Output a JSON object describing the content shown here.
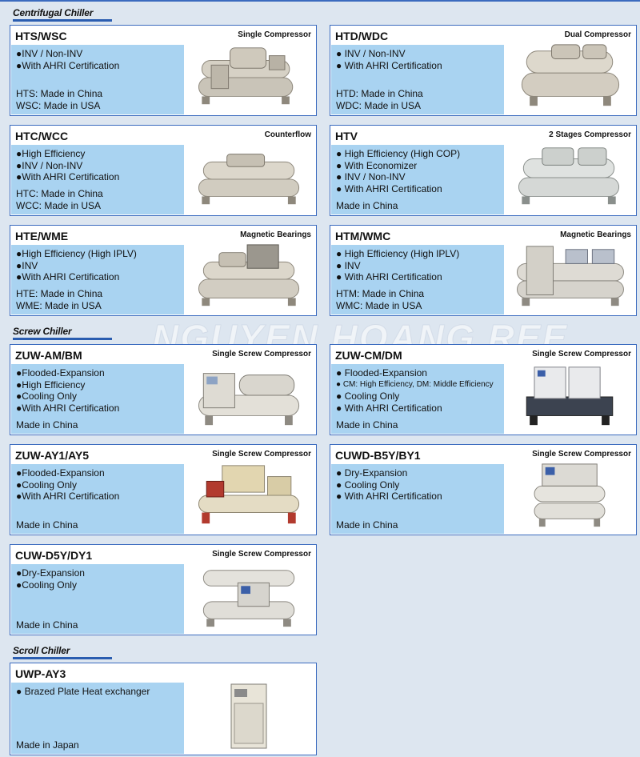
{
  "sections": {
    "centrifugal": "Centrifugal Chiller",
    "screw": "Screw Chiller",
    "scroll": "Scroll Chiller"
  },
  "watermark": "NGUYEN HOANG REE",
  "cards": {
    "hts": {
      "name": "HTS/WSC",
      "tag": "Single Compressor",
      "bullets": [
        "●INV / Non-INV",
        "●With AHRI Certification"
      ],
      "origin": [
        "HTS: Made in China",
        "WSC: Made in USA"
      ]
    },
    "htd": {
      "name": "HTD/WDC",
      "tag": "Dual Compressor",
      "bullets": [
        "● INV / Non-INV",
        "● With AHRI Certification"
      ],
      "origin": [
        "HTD: Made in China",
        "WDC: Made in USA"
      ]
    },
    "htc": {
      "name": "HTC/WCC",
      "tag": "Counterflow",
      "bullets": [
        "●High Efficiency",
        "●INV / Non-INV",
        "●With AHRI Certification"
      ],
      "origin": [
        "HTC: Made in China",
        "WCC: Made in USA"
      ]
    },
    "htv": {
      "name": "HTV",
      "tag": "2 Stages Compressor",
      "bullets": [
        "● High Efficiency (High COP)",
        "● With Economizer",
        "● INV / Non-INV",
        "● With AHRI Certification"
      ],
      "origin": [
        "Made in China"
      ]
    },
    "hte": {
      "name": "HTE/WME",
      "tag": "Magnetic Bearings",
      "bullets": [
        "●High Efficiency (High IPLV)",
        "●INV",
        "●With AHRI Certification"
      ],
      "origin": [
        "HTE: Made in China",
        "WME: Made in USA"
      ]
    },
    "htm": {
      "name": "HTM/WMC",
      "tag": "Magnetic Bearings",
      "bullets": [
        "● High Efficiency (High IPLV)",
        "● INV",
        "● With AHRI Certification"
      ],
      "origin": [
        "HTM: Made in China",
        "WMC: Made in USA"
      ]
    },
    "zuwam": {
      "name": "ZUW-AM/BM",
      "tag": "Single Screw Compressor",
      "bullets": [
        "●Flooded-Expansion",
        "●High Efficiency",
        "●Cooling Only",
        "●With AHRI Certification"
      ],
      "origin": [
        "Made in China"
      ]
    },
    "zuwcm": {
      "name": "ZUW-CM/DM",
      "tag": "Single Screw Compressor",
      "bullets": [
        "● Flooded-Expansion",
        "● CM: High Efficiency, DM: Middle Efficiency",
        "● Cooling Only",
        "● With AHRI Certification"
      ],
      "origin": [
        "Made in China"
      ]
    },
    "zuway": {
      "name": "ZUW-AY1/AY5",
      "tag": "Single Screw Compressor",
      "bullets": [
        "●Flooded-Expansion",
        "●Cooling Only",
        "●With AHRI Certification"
      ],
      "origin": [
        "Made in China"
      ]
    },
    "cuwd": {
      "name": "CUWD-B5Y/BY1",
      "tag": "Single Screw Compressor",
      "bullets": [
        "● Dry-Expansion",
        "● Cooling Only",
        "● With AHRI Certification"
      ],
      "origin": [
        "Made in China"
      ]
    },
    "cuw": {
      "name": "CUW-D5Y/DY1",
      "tag": "Single Screw Compressor",
      "bullets": [
        "●Dry-Expansion",
        "●Cooling Only"
      ],
      "origin": [
        "Made in China"
      ]
    },
    "uwp": {
      "name": "UWP-AY3",
      "tag": "",
      "bullets": [
        "● Brazed Plate Heat exchanger"
      ],
      "origin": [
        "Made in Japan"
      ]
    }
  }
}
